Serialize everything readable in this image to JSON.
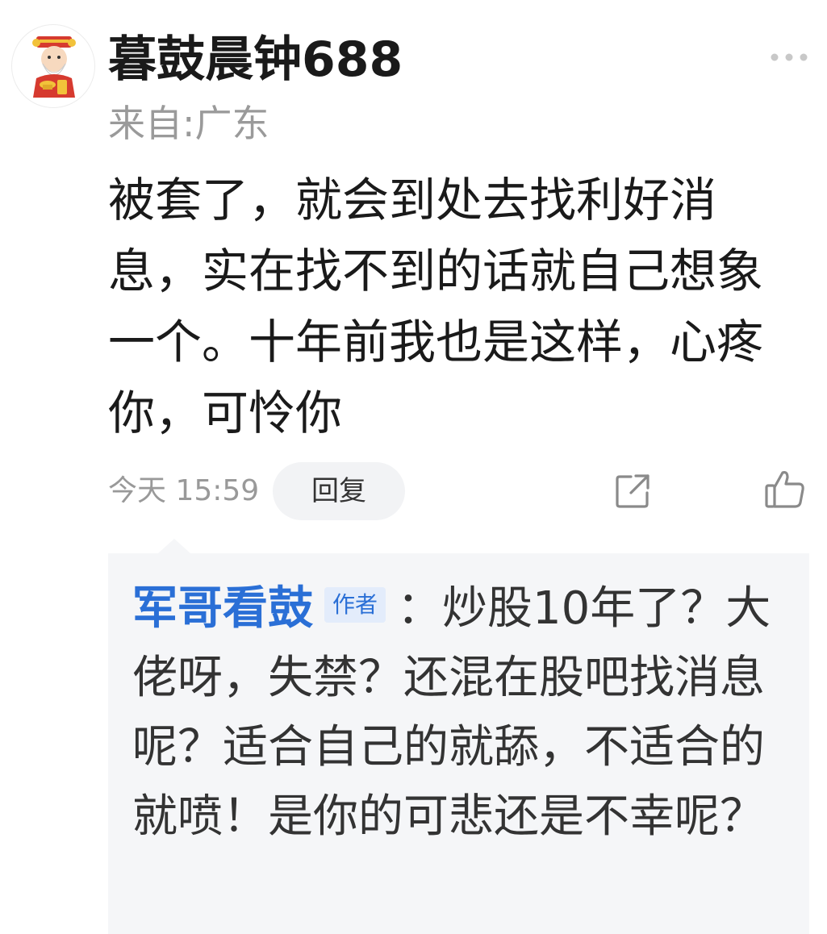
{
  "comment": {
    "username": "暮鼓晨钟688",
    "location": "来自:广东",
    "body": "被套了，就会到处去找利好消息，实在找不到的话就自己想象一个。十年前我也是这样，心疼你，可怜你",
    "time": "今天 15:59",
    "reply_label": "回复",
    "avatar_icon": "god-of-wealth-avatar",
    "more_icon": "more-dots-icon",
    "share_icon": "share-icon",
    "like_icon": "thumbs-up-icon"
  },
  "sub_reply": {
    "author": "军哥看鼓",
    "badge": "作者",
    "separator": "：",
    "text": "炒股10年了？大佬呀，失禁？还混在股吧找消息呢？适合自己的就舔，不适合的就喷！是你的可悲还是不幸呢？"
  },
  "colors": {
    "author_link": "#2a6fd6",
    "panel_bg": "#f5f6f8",
    "muted_text": "#999999"
  }
}
